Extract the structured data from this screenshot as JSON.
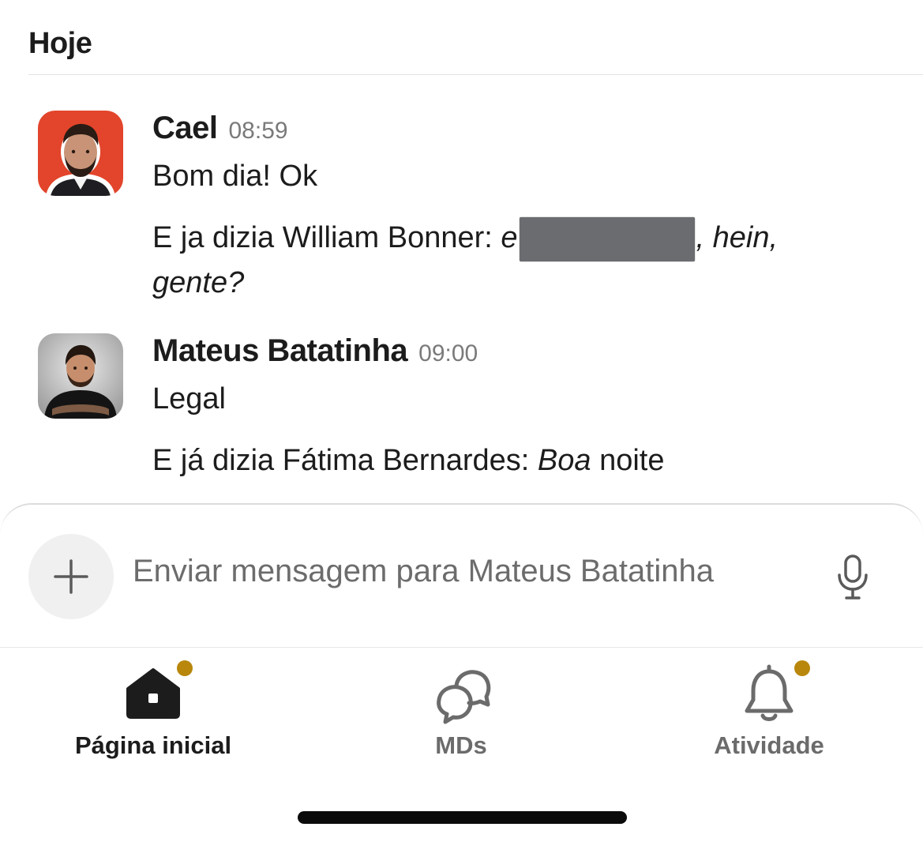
{
  "section": {
    "title": "Hoje"
  },
  "messages": [
    {
      "author": "Cael",
      "time": "08:59",
      "line1": "Bom dia! Ok",
      "line2_prefix": "E ja dizia William Bonner: ",
      "line2_italic_start": "e",
      "line2_italic_end": ", hein,",
      "line3_italic": "gente?"
    },
    {
      "author": "Mateus Batatinha",
      "time": "09:00",
      "line1": "Legal",
      "line2_prefix": "E já dizia Fátima Bernardes: ",
      "line2_italic": "Boa",
      "line2_suffix": " noite"
    }
  ],
  "composer": {
    "placeholder": "Enviar mensagem para Mateus Batatinha"
  },
  "tabs": [
    {
      "label": "Página inicial",
      "icon": "home-icon",
      "active": true,
      "badge": true
    },
    {
      "label": "MDs",
      "icon": "chat-bubbles-icon",
      "active": false,
      "badge": false
    },
    {
      "label": "Atividade",
      "icon": "bell-icon",
      "active": false,
      "badge": true
    }
  ],
  "colors": {
    "badge": "#b8870b",
    "avatar1_bg": "#e2452b",
    "avatar2_bg": "#1a1a1a"
  }
}
